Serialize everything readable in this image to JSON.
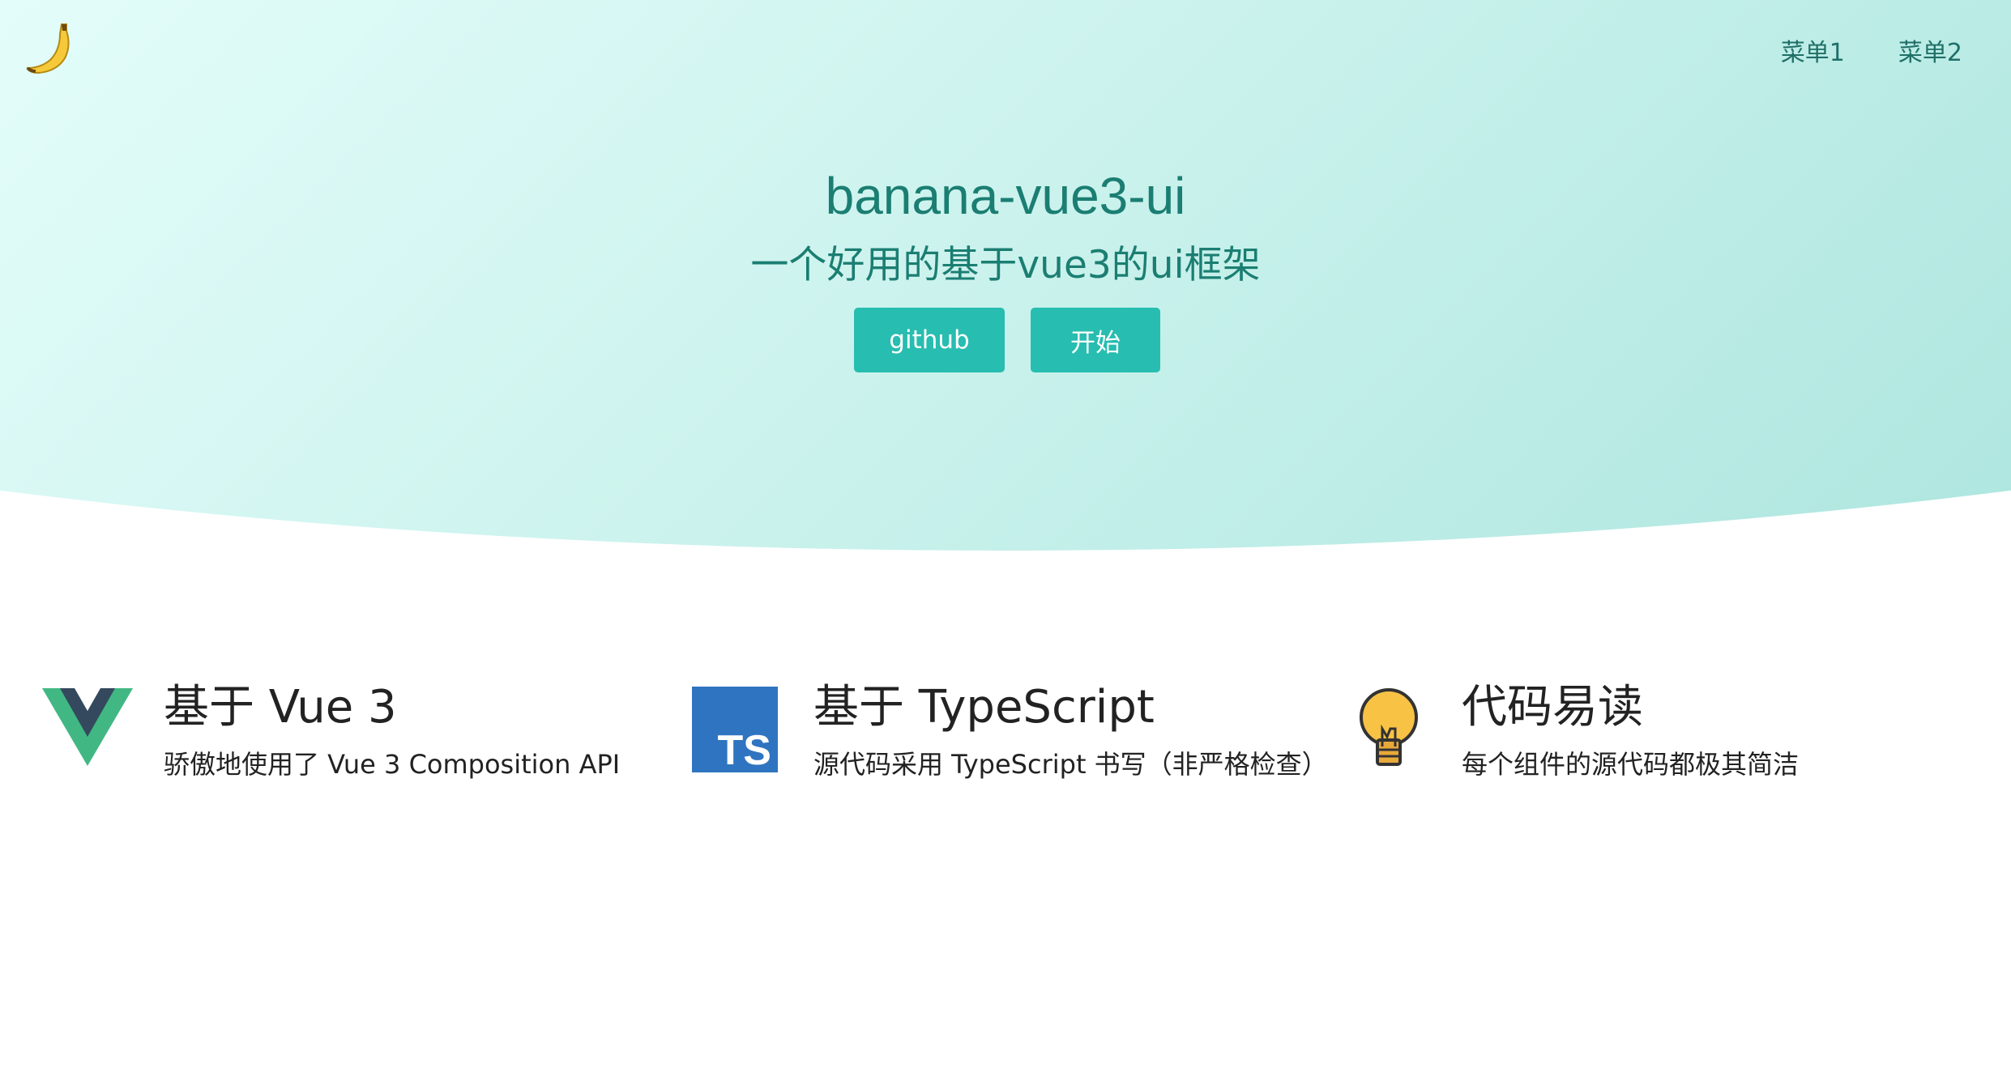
{
  "header": {
    "logo_icon": "banana-icon",
    "menu": [
      {
        "label": "菜单1"
      },
      {
        "label": "菜单2"
      }
    ]
  },
  "hero": {
    "title": "banana-vue3-ui",
    "subtitle": "一个好用的基于vue3的ui框架",
    "buttons": {
      "github_label": "github",
      "start_label": "开始"
    },
    "colors": {
      "accent": "#27bdb0",
      "title_text": "#1b7e72",
      "background_light": "#e3fdfa",
      "background_dark": "#aee6df"
    }
  },
  "features": [
    {
      "icon": "vue-logo-icon",
      "title": "基于 Vue 3",
      "desc": "骄傲地使用了 Vue 3 Composition API"
    },
    {
      "icon": "typescript-logo-icon",
      "icon_text": "TS",
      "title": "基于 TypeScript",
      "desc": "源代码采用 TypeScript 书写（非严格检查）"
    },
    {
      "icon": "lightbulb-icon",
      "title": "代码易读",
      "desc": "每个组件的源代码都极其简洁"
    }
  ]
}
